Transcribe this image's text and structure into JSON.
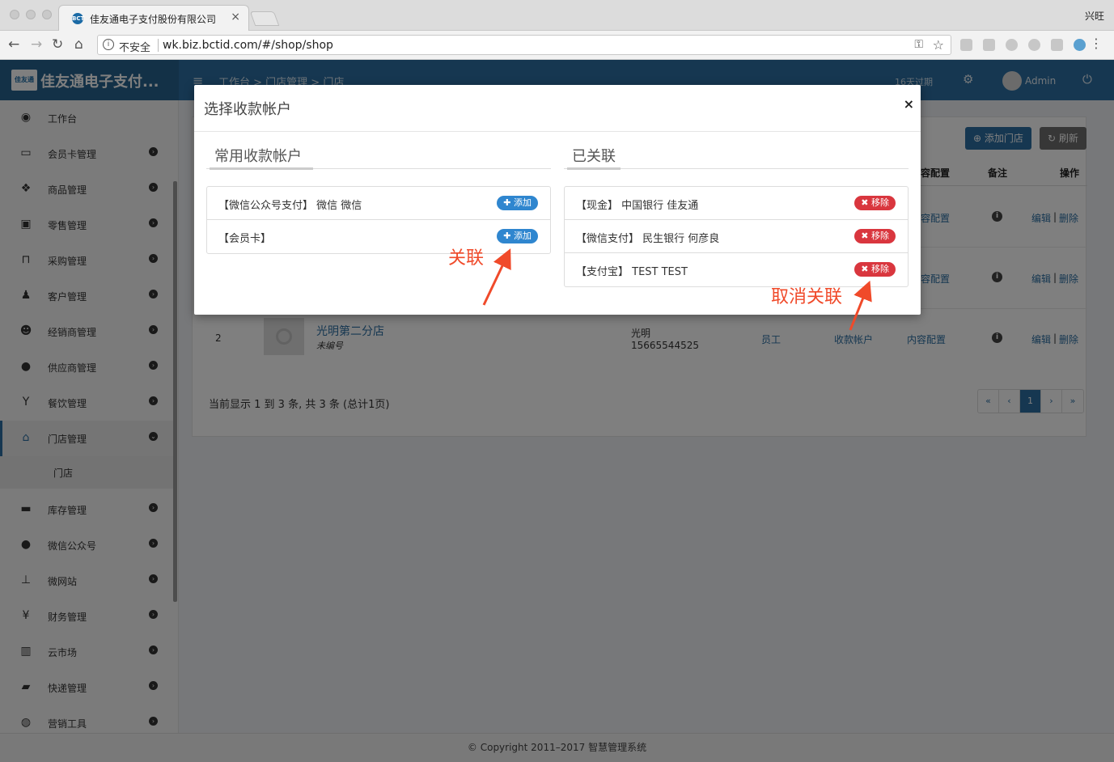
{
  "browser": {
    "tab_title": "佳友通电子支付股份有限公司",
    "favicon_text": "BCT",
    "profile_name": "兴旺",
    "security_label": "不安全",
    "url": "wk.biz.bctid.com/#/shop/shop"
  },
  "header": {
    "logo_text": "佳友通电子支付...",
    "logo_mark": "佳友通",
    "breadcrumb": "工作台 > 门店管理 > 门店",
    "expire_text": "16天过期",
    "user": "Admin"
  },
  "sidebar": {
    "items": [
      {
        "label": "工作台",
        "icon": "dashboard-icon"
      },
      {
        "label": "会员卡管理",
        "icon": "credit-card-icon"
      },
      {
        "label": "商品管理",
        "icon": "cubes-icon"
      },
      {
        "label": "零售管理",
        "icon": "money-icon"
      },
      {
        "label": "采购管理",
        "icon": "cart-icon"
      },
      {
        "label": "客户管理",
        "icon": "person-icon"
      },
      {
        "label": "经销商管理",
        "icon": "users-icon"
      },
      {
        "label": "供应商管理",
        "icon": "user-icon"
      },
      {
        "label": "餐饮管理",
        "icon": "glass-icon"
      },
      {
        "label": "门店管理",
        "icon": "home-icon"
      },
      {
        "label": "库存管理",
        "icon": "archive-icon"
      },
      {
        "label": "微信公众号",
        "icon": "wechat-icon"
      },
      {
        "label": "微网站",
        "icon": "sitemap-icon"
      },
      {
        "label": "财务管理",
        "icon": "yen-icon"
      },
      {
        "label": "云市场",
        "icon": "building-icon"
      },
      {
        "label": "快递管理",
        "icon": "truck-icon"
      },
      {
        "label": "营销工具",
        "icon": "globe-icon"
      }
    ],
    "sub_item": "门店"
  },
  "main": {
    "add_shop_label": "添加门店",
    "refresh_label": "刷新",
    "columns": {
      "content_config": "容配置",
      "remark": "备注",
      "ops": "操作"
    },
    "rows": [
      {
        "content": "容配置",
        "edit": "编辑",
        "delete": "删除"
      },
      {
        "content": "容配置",
        "edit": "编辑",
        "delete": "删除"
      }
    ],
    "row3": {
      "index": "2",
      "name": "光明第二分店",
      "code": "未编号",
      "area": "光明",
      "phone": "15665544525",
      "staff": "员工",
      "account": "收款帐户",
      "content": "内容配置",
      "edit": "编辑",
      "delete": "删除"
    },
    "summary": "当前显示 1 到 3 条, 共 3 条 (总计1页)",
    "pager": {
      "first": "«",
      "prev": "‹",
      "current": "1",
      "next": "›",
      "last": "»"
    }
  },
  "footer": "© Copyright 2011–2017 智慧管理系统",
  "modal": {
    "title": "选择收款帐户",
    "close": "×",
    "left_title": "常用收款帐户",
    "right_title": "已关联",
    "available": [
      {
        "text": "【微信公众号支付】 微信 微信",
        "action": "添加"
      },
      {
        "text": "【会员卡】",
        "action": "添加"
      }
    ],
    "linked": [
      {
        "text": "【现金】 中国银行 佳友通",
        "action": "移除"
      },
      {
        "text": "【微信支付】 民生银行 何彦良",
        "action": "移除"
      },
      {
        "text": "【支付宝】 TEST TEST",
        "action": "移除"
      }
    ]
  },
  "annotations": {
    "link": "关联",
    "unlink": "取消关联"
  },
  "colors": {
    "primary": "#2c6fa3",
    "add": "#2f86cf",
    "remove": "#d9363e",
    "annotation": "#f04a2a"
  }
}
